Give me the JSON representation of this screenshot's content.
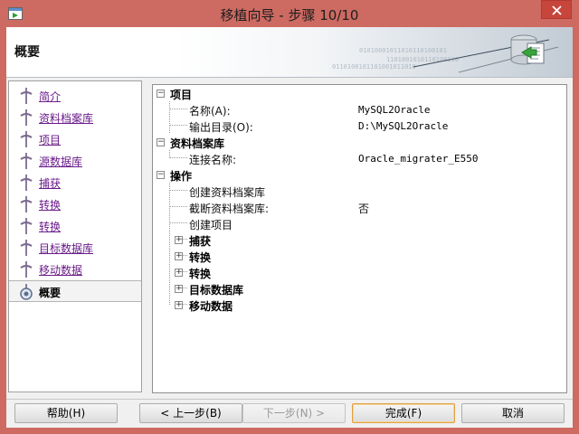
{
  "window": {
    "title": "移植向导 - 步骤 10/10",
    "close_glyph": "✕"
  },
  "banner": {
    "title": "概要"
  },
  "nav": {
    "items": [
      {
        "label": "简介",
        "icon": "step-node-icon",
        "active": false
      },
      {
        "label": "资料档案库",
        "icon": "step-node-icon",
        "active": false
      },
      {
        "label": "项目",
        "icon": "step-node-icon",
        "active": false
      },
      {
        "label": "源数据库",
        "icon": "step-node-icon",
        "active": false
      },
      {
        "label": "捕获",
        "icon": "step-node-icon",
        "active": false
      },
      {
        "label": "转换",
        "icon": "step-node-icon",
        "active": false
      },
      {
        "label": "转换",
        "icon": "step-node-icon",
        "active": false
      },
      {
        "label": "目标数据库",
        "icon": "step-node-icon",
        "active": false
      },
      {
        "label": "移动数据",
        "icon": "step-node-icon",
        "active": false
      },
      {
        "label": "概要",
        "icon": "current-step-icon",
        "active": true
      }
    ]
  },
  "tree": {
    "project": {
      "header": "项目",
      "name_label": "名称(A):",
      "name_value": "MySQL2Oracle",
      "dir_label": "输出目录(O):",
      "dir_value": "D:\\MySQL2Oracle"
    },
    "repository": {
      "header": "资料档案库",
      "conn_label": "连接名称:",
      "conn_value": "Oracle_migrater_E550"
    },
    "operations": {
      "header": "操作",
      "create_repo": "创建资料档案库",
      "truncate_label": "截断资料档案库:",
      "truncate_value": "否",
      "create_project": "创建项目",
      "subs": [
        "捕获",
        "转换",
        "转换",
        "目标数据库",
        "移动数据"
      ]
    },
    "expand_glyph": "+",
    "collapse_glyph": "−"
  },
  "buttons": {
    "help": "帮助(H)",
    "back": "< 上一步(B)",
    "next": "下一步(N) >",
    "finish": "完成(F)",
    "cancel": "取消"
  },
  "colors": {
    "titlebar": "#cd6a62",
    "link": "#6a1b8a",
    "default_button_border": "#e0a040"
  }
}
